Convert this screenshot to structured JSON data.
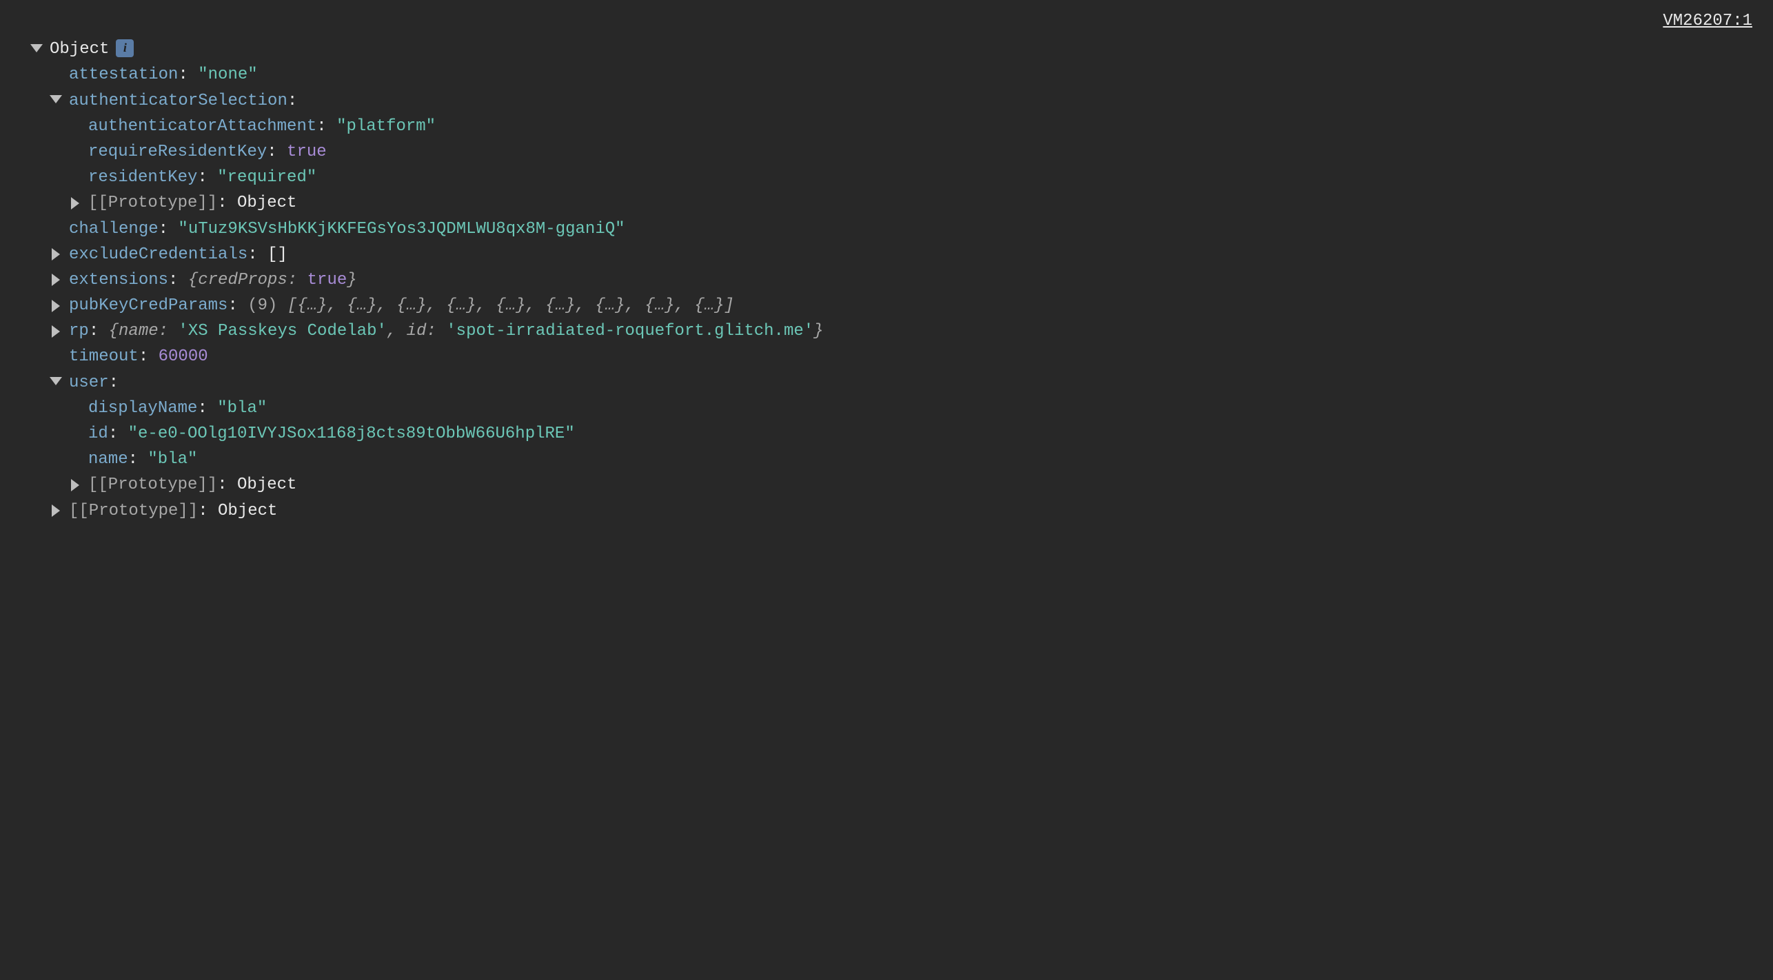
{
  "sourceLink": "VM26207:1",
  "rootLabel": "Object",
  "infoGlyph": "i",
  "props": {
    "attestation": {
      "key": "attestation",
      "value": "\"none\""
    },
    "authenticatorSelection": {
      "key": "authenticatorSelection"
    },
    "authenticatorAttachment": {
      "key": "authenticatorAttachment",
      "value": "\"platform\""
    },
    "requireResidentKey": {
      "key": "requireResidentKey",
      "value": "true"
    },
    "residentKey": {
      "key": "residentKey",
      "value": "\"required\""
    },
    "proto1": {
      "key": "[[Prototype]]",
      "value": "Object"
    },
    "challenge": {
      "key": "challenge",
      "value": "\"uTuz9KSVsHbKKjKKFEGsYos3JQDMLWU8qx8M-gganiQ\""
    },
    "excludeCredentials": {
      "key": "excludeCredentials",
      "value": "[]"
    },
    "extensions": {
      "key": "extensions",
      "open": "{",
      "innerKey": "credProps",
      "innerVal": "true",
      "close": "}"
    },
    "pubKeyCredParams": {
      "key": "pubKeyCredParams",
      "count": "(9)",
      "preview": "[{…}, {…}, {…}, {…}, {…}, {…}, {…}, {…}, {…}]"
    },
    "rp": {
      "key": "rp",
      "open": "{",
      "k1": "name",
      "v1": "'XS Passkeys Codelab'",
      "k2": "id",
      "v2": "'spot-irradiated-roquefort.glitch.me'",
      "close": "}"
    },
    "timeout": {
      "key": "timeout",
      "value": "60000"
    },
    "user": {
      "key": "user"
    },
    "displayName": {
      "key": "displayName",
      "value": "\"bla\""
    },
    "userId": {
      "key": "id",
      "value": "\"e-e0-OOlg10IVYJSox1168j8cts89tObbW66U6hplRE\""
    },
    "userName": {
      "key": "name",
      "value": "\"bla\""
    },
    "proto2": {
      "key": "[[Prototype]]",
      "value": "Object"
    },
    "proto3": {
      "key": "[[Prototype]]",
      "value": "Object"
    }
  }
}
